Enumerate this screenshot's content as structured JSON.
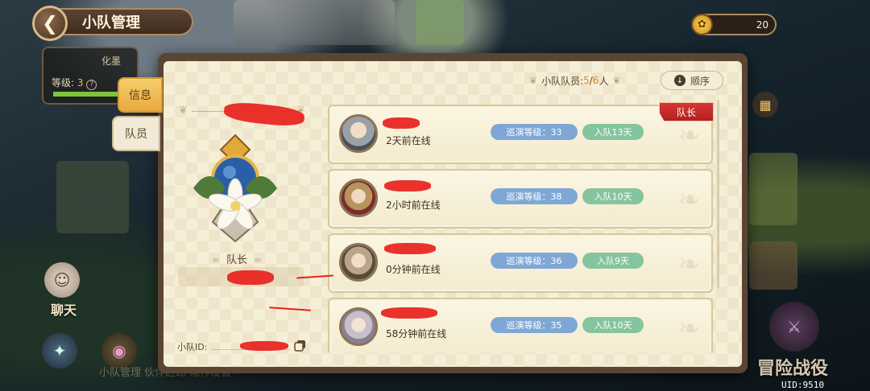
{
  "header": {
    "title": "小队管理",
    "currency_value": "20"
  },
  "behind": {
    "name": "化墨",
    "level_label": "等级:",
    "level_value": "3",
    "level_progress": 0.85
  },
  "tabs": [
    {
      "label": "信息",
      "active": true
    },
    {
      "label": "队员",
      "active": false
    }
  ],
  "team": {
    "leader_label": "队长",
    "id_label": "小队ID:"
  },
  "members_header": {
    "count_label": "小队队员:",
    "count_current": "5",
    "count_sep": "/",
    "count_max": "6",
    "count_unit": "人",
    "sort_label": "顺序"
  },
  "captain_badge": "队长",
  "members": [
    {
      "online": "2天前在线",
      "level": "巡演等级：33",
      "days": "入队13天",
      "is_captain": true
    },
    {
      "online": "2小时前在线",
      "level": "巡演等级：38",
      "days": "入队10天",
      "is_captain": false
    },
    {
      "online": "0分钟前在线",
      "level": "巡演等级：36",
      "days": "入队9天",
      "is_captain": false
    },
    {
      "online": "58分钟前在线",
      "level": "巡演等级：35",
      "days": "入队10天",
      "is_captain": false
    }
  ],
  "side": {
    "chat_label": "聊天",
    "bottom_faded": "小队管理 伙伴赶路 动作发言",
    "battle_label": "冒险战役",
    "uid": "UID:9510"
  },
  "colors": {
    "accent_orange": "#d9892a",
    "pill_blue": "#7ea7d6",
    "pill_green": "#86c49f",
    "captain_red": "#c52a2a"
  }
}
